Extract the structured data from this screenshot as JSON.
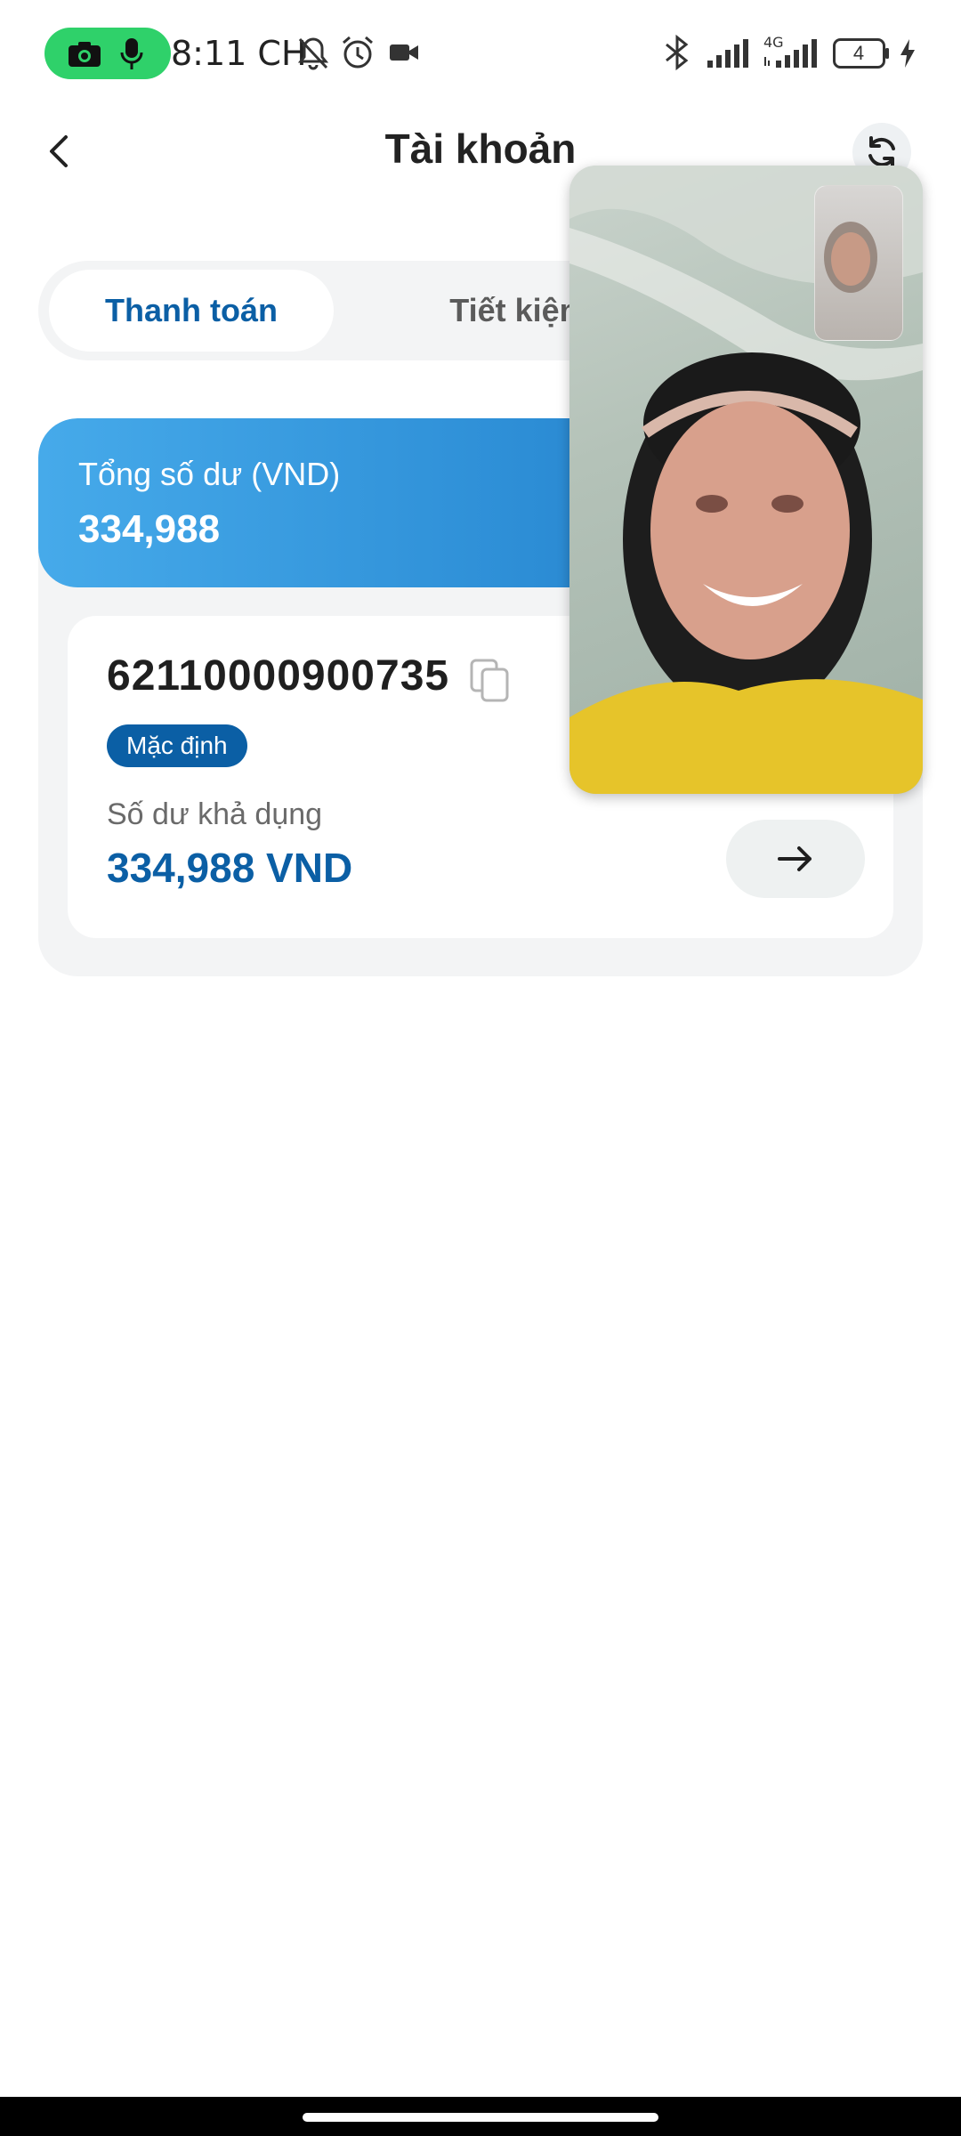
{
  "status_bar": {
    "time": "8:11 CH",
    "network": "4G",
    "battery": "4",
    "icons": [
      "camera-icon",
      "mic-icon",
      "bell-off-icon",
      "alarm-icon",
      "video-icon",
      "bluetooth-icon",
      "signal-icon",
      "battery-icon",
      "charging-icon"
    ]
  },
  "header": {
    "title": "Tài khoản",
    "back_icon": "chevron-left-icon",
    "refresh_icon": "refresh-icon"
  },
  "tabs": [
    {
      "label": "Thanh toán",
      "active": true
    },
    {
      "label": "Tiết kiệm",
      "active": false
    }
  ],
  "balance": {
    "label": "Tổng số dư (VND)",
    "value": "334,988"
  },
  "account": {
    "number": "62110000900735",
    "badge": "Mặc định",
    "available_label": "Số dư khả dụng",
    "available_value": "334,988 VND"
  },
  "colors": {
    "accent": "#0b5fa5",
    "banner_start": "#46aaea",
    "banner_end": "#1f74c0",
    "recording_pill": "#2fd16a"
  }
}
